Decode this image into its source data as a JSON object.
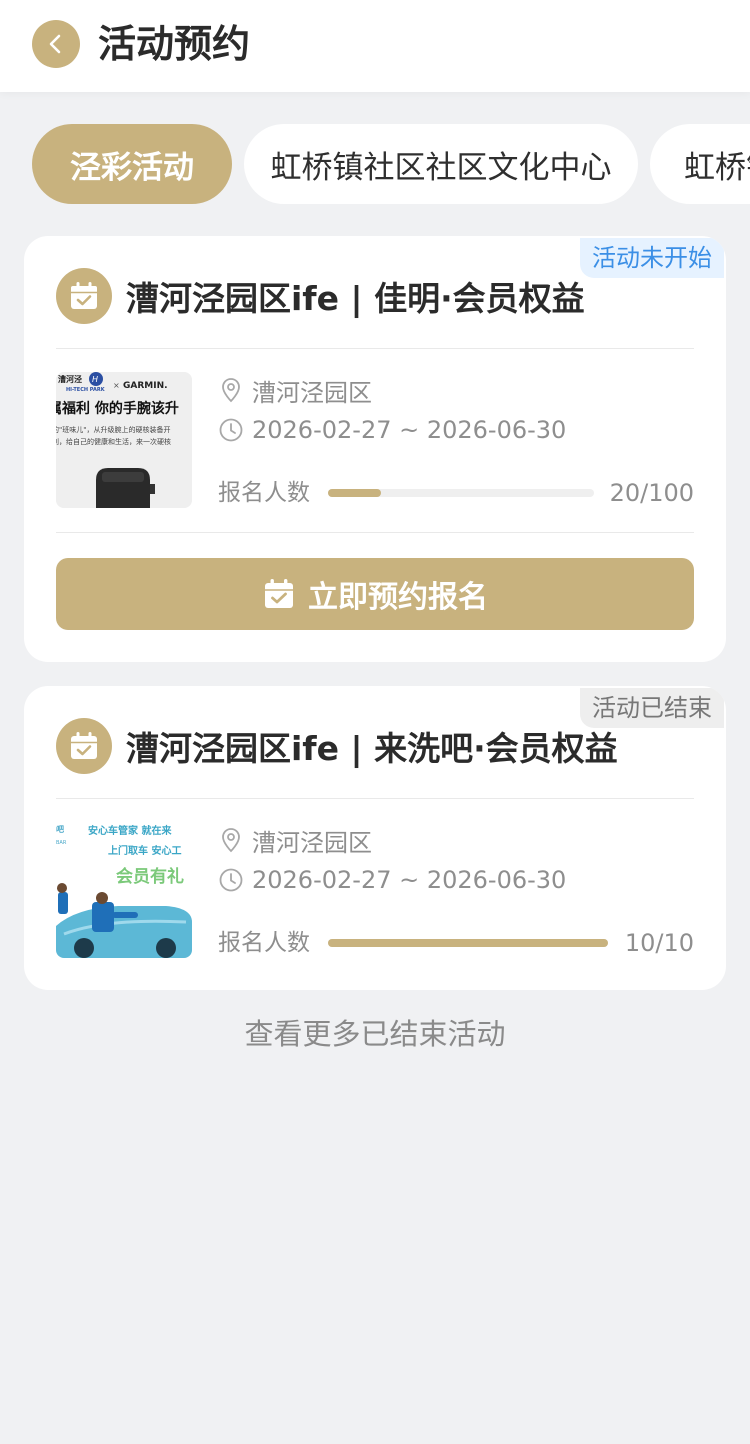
{
  "header": {
    "title": "活动预约"
  },
  "tabs": [
    {
      "label": "泾彩活动",
      "active": true
    },
    {
      "label": "虹桥镇社区社区文化中心",
      "active": false
    },
    {
      "label": "虹桥镇",
      "active": false
    }
  ],
  "activities": [
    {
      "status": "活动未开始",
      "status_type": "upcoming",
      "title": "漕河泾园区ife | 佳明·会员权益",
      "location": "漕河泾园区",
      "date_range": "2026-02-27 ~  2026-06-30",
      "reg_label": "报名人数",
      "reg_count": "20/100",
      "progress": 0.2,
      "button_label": "立即预约报名",
      "thumb_text": {
        "logo_left": "漕河泾",
        "logo_sub": "HI-TECH PARK",
        "logo_x": "×",
        "logo_right": "GARMIN.",
        "headline": "属福利 你的手腕该升",
        "body1": "的\"班味儿\"，从升级腕上的硬核装备开",
        "body2": "利，给自己的健康和生活，来一次硬核"
      }
    },
    {
      "status": "活动已结束",
      "status_type": "ended",
      "title": "漕河泾园区ife | 来洗吧·会员权益",
      "location": "漕河泾园区",
      "date_range": "2026-02-27 ~  2026-06-30",
      "reg_label": "报名人数",
      "reg_count": "10/10",
      "progress": 1.0,
      "thumb_text": {
        "line1a": "吧",
        "line1b": "安心车管家  就在来",
        "line2a": "BAR",
        "line2b": "上门取车  安心工",
        "line3": "会员有礼"
      }
    }
  ],
  "more_link": "查看更多已结束活动",
  "colors": {
    "accent": "#c8b27e",
    "status_upcoming_text": "#3b8fe6",
    "status_upcoming_bg": "#e6f2ff",
    "status_ended_text": "#777777",
    "status_ended_bg": "#eeeeee",
    "background": "#f0f1f3"
  },
  "icons": {
    "back": "chevron-left-icon",
    "calendar": "calendar-check-icon",
    "location": "location-pin-icon",
    "time": "clock-icon"
  }
}
